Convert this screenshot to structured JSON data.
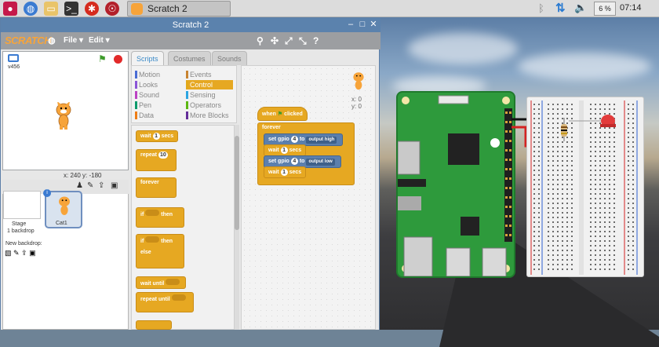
{
  "taskbar": {
    "task_title": "Scratch 2",
    "volume_label": "6 %",
    "clock": "07:14"
  },
  "window": {
    "title": "Scratch 2",
    "menu_file": "File ▾",
    "menu_edit": "Edit ▾",
    "logo": "SCRATCH"
  },
  "stage": {
    "version": "v456",
    "coords": "x: 240  y: -180"
  },
  "sprites": {
    "stage_label": "Stage",
    "stage_backdrops": "1 backdrop",
    "new_backdrop": "New backdrop:",
    "sprite_name": "Cat1"
  },
  "tabs": [
    "Scripts",
    "Costumes",
    "Sounds"
  ],
  "categories": [
    {
      "label": "Motion",
      "color": "#4a6cd4"
    },
    {
      "label": "Looks",
      "color": "#8a55d7"
    },
    {
      "label": "Sound",
      "color": "#bb42c3"
    },
    {
      "label": "Pen",
      "color": "#0e9a6c"
    },
    {
      "label": "Data",
      "color": "#ee7d16"
    },
    {
      "label": "Events",
      "color": "#c88330"
    },
    {
      "label": "Control",
      "color": "#e1a91a"
    },
    {
      "label": "Sensing",
      "color": "#2ca5e2"
    },
    {
      "label": "Operators",
      "color": "#5cb712"
    },
    {
      "label": "More Blocks",
      "color": "#632d99"
    }
  ],
  "palette": {
    "wait": "wait",
    "wait_num": "1",
    "secs": "secs",
    "repeat": "repeat",
    "repeat_num": "10",
    "forever": "forever",
    "if": "if",
    "then": "then",
    "else": "else",
    "wait_until": "wait until",
    "repeat_until": "repeat until"
  },
  "script": {
    "when": "when",
    "clicked": "clicked",
    "forever": "forever",
    "set_gpio": "set gpio",
    "gpio_num": "4",
    "to": "to",
    "output_high": "output high",
    "output_low": "output low",
    "wait": "wait",
    "wait_num": "1",
    "secs": "secs",
    "sprite_x": "x: 0",
    "sprite_y": "y: 0"
  },
  "colors": {
    "control": "#e6a822",
    "titlebar": "#5b82ad",
    "pi_green": "#2e9a3c",
    "led": "#e23b3b"
  }
}
